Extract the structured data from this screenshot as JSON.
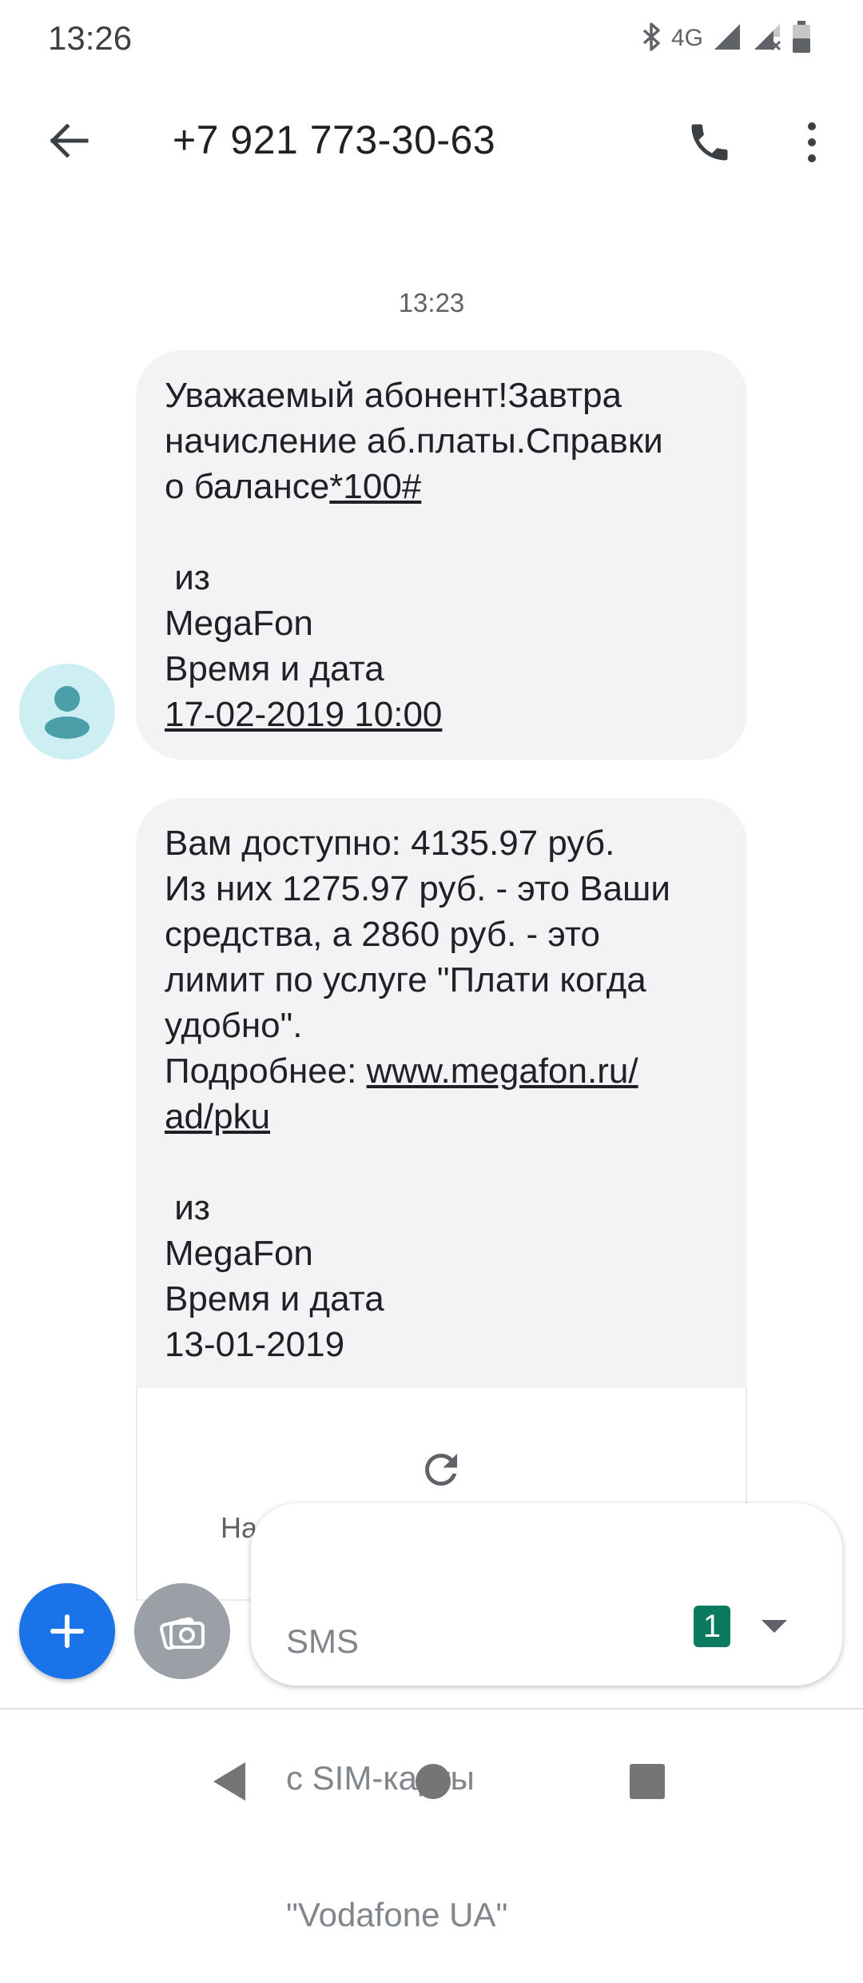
{
  "status_bar": {
    "time": "13:26",
    "network_label": "4G",
    "icons": [
      "bluetooth-icon",
      "signal-icon",
      "signal-noconnection-icon",
      "battery-icon"
    ]
  },
  "app_bar": {
    "title": "+7 921 773-30-63",
    "icons": [
      "arrow-back-icon",
      "phone-icon",
      "more-vert-icon"
    ]
  },
  "conversation": {
    "timestamp": "13:23",
    "messages": [
      {
        "lines": [
          "Уважаемый абонент!Завтра",
          "начисление аб.платы.Справки",
          "о балансе",
          "*100#",
          "",
          " из",
          "MegaFon",
          "Время и дата",
          "17-02-2019 10:00"
        ]
      },
      {
        "lines": [
          "Вам доступно: 4135.97 руб.",
          "Из них 1275.97 руб. - это Ваши",
          "средства, а 2860 руб. - это",
          "лимит по услуге \"Плати когда",
          "удобно\".",
          "Подробнее: ",
          "www.megafon.ru/",
          "ad/pku",
          "",
          " из",
          "MegaFon",
          "Время и дата",
          "13-01-2019"
        ]
      }
    ],
    "link_preview": {
      "label": "На"
    }
  },
  "compose": {
    "placeholder_lines": [
      "SMS",
      "с SIM-карты",
      "\"Vodafone UA\""
    ],
    "sim_number": "1"
  },
  "colors": {
    "bubble_bg": "#f1f3f4",
    "fab_blue": "#1a73e8",
    "avatar_bg": "#cdeef3",
    "avatar_fg": "#4a9fa8",
    "sim_badge": "#0b7a5e"
  }
}
